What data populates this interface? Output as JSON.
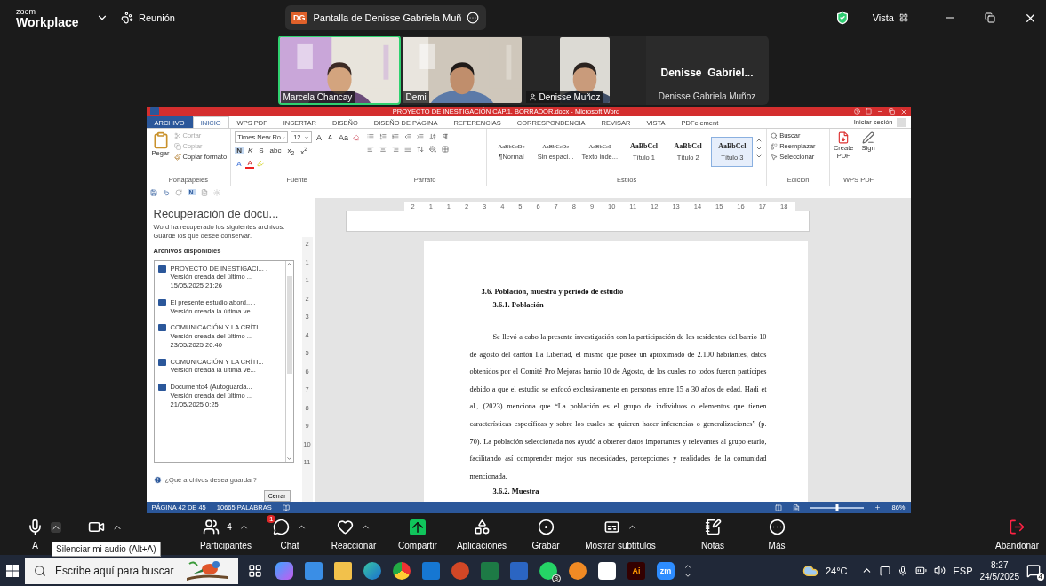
{
  "zoom_bar": {
    "brand_small": "zoom",
    "brand": "Workplace",
    "meeting": "Reunión",
    "share_initials": "DG",
    "share_label": "Pantalla de Denisse Gabriela Muñ",
    "view": "Vista"
  },
  "videos": [
    {
      "kind": "camera",
      "name": "Marcela Chancay",
      "selected": true
    },
    {
      "kind": "camera",
      "name": "Demi",
      "selected": false
    },
    {
      "kind": "camera",
      "name": "Denisse Muñoz",
      "selected": false
    },
    {
      "kind": "name_only",
      "display": "Denisse  Gabriel...",
      "name": "Denisse Gabriela Muñoz",
      "selected": false
    }
  ],
  "word": {
    "title": "PROYECTO DE INESTIGACIÓN CAP.1. BORRADOR.docx - Microsoft Word",
    "sign_in": "Iniciar sesión",
    "tabs": [
      {
        "label": "ARCHIVO",
        "kind": "file",
        "selected": false
      },
      {
        "label": "INICIO",
        "kind": "tab",
        "selected": true
      },
      {
        "label": "WPS PDF",
        "kind": "tab",
        "selected": false
      },
      {
        "label": "INSERTAR",
        "kind": "tab",
        "selected": false
      },
      {
        "label": "DISEÑO",
        "kind": "tab",
        "selected": false
      },
      {
        "label": "DISEÑO DE PÁGINA",
        "kind": "tab",
        "selected": false
      },
      {
        "label": "REFERENCIAS",
        "kind": "tab",
        "selected": false
      },
      {
        "label": "CORRESPONDENCIA",
        "kind": "tab",
        "selected": false
      },
      {
        "label": "REVISAR",
        "kind": "tab",
        "selected": false
      },
      {
        "label": "VISTA",
        "kind": "tab",
        "selected": false
      },
      {
        "label": "PDFelement",
        "kind": "tab",
        "selected": false
      }
    ],
    "clipboard": {
      "label": "Portapapeles",
      "paste": "Pegar",
      "items": [
        {
          "label": "Cortar",
          "disabled": true
        },
        {
          "label": "Copiar",
          "disabled": true
        },
        {
          "label": "Copiar formato",
          "disabled": false
        }
      ]
    },
    "font": {
      "label": "Fuente",
      "family": "Times New Ro",
      "size": "12",
      "size_buttons": [
        "A",
        "A",
        "Aa"
      ],
      "format": [
        "N",
        "K",
        "S",
        "abc",
        "x$_{2}$",
        "x$^{2}$"
      ],
      "effects": [
        "A",
        "A"
      ]
    },
    "paragraph": {
      "label": "Párrafo"
    },
    "styles": {
      "label": "Estilos",
      "items": [
        {
          "sample": "AaBbCcDc",
          "name": "¶Normal",
          "kind": "plain",
          "selected": false
        },
        {
          "sample": "AaBbCcDc",
          "name": "Sin espaci...",
          "kind": "plain",
          "selected": false
        },
        {
          "sample": "AaBbCcI",
          "name": "Texto inde...",
          "kind": "serif",
          "selected": false
        },
        {
          "sample": "AaBbCcl",
          "name": "Título 1",
          "kind": "heading",
          "selected": false
        },
        {
          "sample": "AaBbCcl",
          "name": "Título 2",
          "kind": "heading",
          "selected": false
        },
        {
          "sample": "AaBbCcl",
          "name": "Título 3",
          "kind": "heading",
          "selected": true
        }
      ]
    },
    "editing": {
      "label": "Edición",
      "items": [
        "Buscar",
        "Reemplazar",
        "Seleccionar"
      ]
    },
    "wps": {
      "label": "WPS PDF",
      "items": [
        "Create PDF",
        "Sign"
      ]
    },
    "quick_access": {
      "letter": "N"
    },
    "recovery": {
      "title": "Recuperación de docu...",
      "description": "Word ha recuperado los siguientes archivos. Guarde los que desee conservar.",
      "list_title": "Archivos disponibles",
      "files": [
        {
          "name": "PROYECTO DE INESTIGACI... .",
          "detail": "Versión creada del último ...",
          "date": "15/05/2025 21:26"
        },
        {
          "name": "El presente estudio abord... .",
          "detail": "Versión creada la última ve..."
        },
        {
          "name": "COMUNICACIÓN Y LA CRÍTI...",
          "detail": "Versión creada del último ...",
          "date": "23/05/2025 20:40"
        },
        {
          "name": "COMUNICACIÓN Y LA CRÍTI...",
          "detail": "Versión creada la última ve..."
        },
        {
          "name": "Documento4  (Autoguarda...",
          "detail": "Versión creada del último ...",
          "date": "21/05/2025 0:25"
        }
      ],
      "help": "¿Qué archivos desea guardar?",
      "close": "Cerrar"
    },
    "ruler": [
      "2",
      "1",
      "1",
      "2",
      "3",
      "4",
      "5",
      "6",
      "7",
      "8",
      "9",
      "10",
      "11",
      "12",
      "13",
      "14",
      "15",
      "16",
      "17",
      "18"
    ],
    "vertical_ruler": [
      "2",
      "1",
      "1",
      "2",
      "3",
      "4",
      "5",
      "6",
      "7",
      "8",
      "9",
      "10",
      "11"
    ],
    "document": {
      "heading": "3.6. Población, muestra y periodo de estudio",
      "subheading": "3.6.1.  Población",
      "paragraph": "Se llevó a cabo la presente investigación con la participación de los residentes del barrio 10 de agosto del cantón La Libertad, el mismo que posee un aproximado de 2.100 habitantes, datos obtenidos por el Comité Pro Mejoras barrio 10 de Agosto, de los cuales no todos fueron partícipes debido a que el estudio se enfocó exclusivamente en personas entre 15 a 30 años de edad. Hadi et al., (2023) menciona que “La población es el grupo de individuos o elementos que tienen características específicas y sobre los cuales se quieren hacer inferencias o generalizaciones” (p. 70). La población seleccionada nos ayudó a obtener datos importantes y relevantes al grupo etario, facilitando así comprender mejor sus necesidades, percepciones y realidades de la comunidad mencionada.",
      "next_heading": "3.6.2.  Muestra"
    },
    "status": {
      "page": "PÁGINA 42 DE 45",
      "words": "10665 PALABRAS",
      "zoom": "86%",
      "level": 0.5
    }
  },
  "meeting_toolbar": {
    "audio_label": "A",
    "tooltip": "Silenciar mi audio (Alt+A)",
    "items": [
      {
        "kind": "participants",
        "label": "Participantes",
        "count": "4",
        "menu": true
      },
      {
        "kind": "chat",
        "label": "Chat",
        "badge": "1",
        "menu": true
      },
      {
        "kind": "react",
        "label": "Reaccionar",
        "menu": true
      },
      {
        "kind": "share",
        "label": "Compartir",
        "menu": false
      },
      {
        "kind": "apps",
        "label": "Aplicaciones",
        "menu": false
      },
      {
        "kind": "record",
        "label": "Grabar",
        "menu": false
      },
      {
        "kind": "captions",
        "label": "Mostrar subtítulos",
        "menu": true
      },
      {
        "kind": "notes",
        "label": "Notas",
        "menu": false
      },
      {
        "kind": "more",
        "label": "Más",
        "menu": false
      }
    ],
    "leave": "Abandonar"
  },
  "taskbar": {
    "search": "Escribe aquí para buscar",
    "apps": [
      {
        "kind": "taskview"
      },
      {
        "kind": "copilot"
      },
      {
        "kind": "store"
      },
      {
        "kind": "explorer"
      },
      {
        "kind": "edge"
      },
      {
        "kind": "chrome"
      },
      {
        "kind": "outlook"
      },
      {
        "kind": "powerpoint"
      },
      {
        "kind": "excel"
      },
      {
        "kind": "word"
      },
      {
        "kind": "whatsapp",
        "badge": "3"
      },
      {
        "kind": "vpn"
      },
      {
        "kind": "capcut"
      },
      {
        "kind": "illustrator",
        "text": "Ai"
      },
      {
        "kind": "zoom",
        "text": "zm"
      }
    ],
    "weather": "24°C",
    "language": "ESP",
    "time": "8:27",
    "date": "24/5/2025",
    "notifications": "4"
  }
}
